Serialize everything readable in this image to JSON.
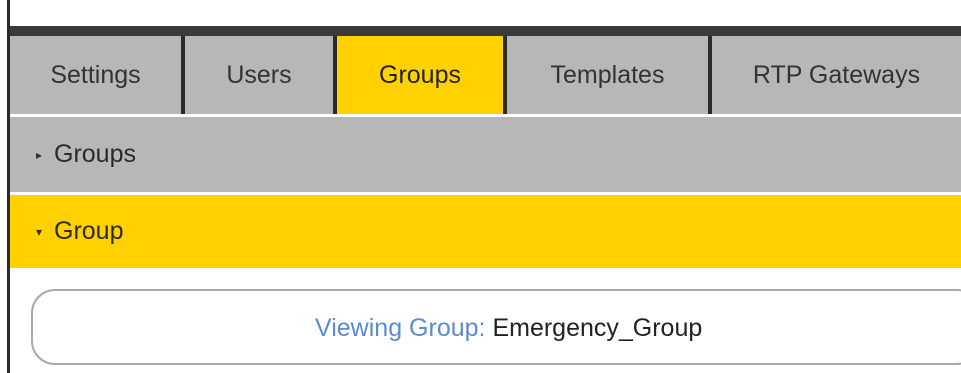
{
  "tabs": [
    {
      "label": "Settings",
      "active": false
    },
    {
      "label": "Users",
      "active": false
    },
    {
      "label": "Groups",
      "active": true
    },
    {
      "label": "Templates",
      "active": false
    },
    {
      "label": "RTP Gateways",
      "active": false
    }
  ],
  "sections": {
    "groups": {
      "label": "Groups",
      "expanded": false,
      "caret_icon": "caret-right-icon"
    },
    "group": {
      "label": "Group",
      "expanded": true,
      "caret_icon": "caret-down-icon"
    }
  },
  "viewing": {
    "label": "Viewing Group:",
    "value": "Emergency_Group"
  },
  "colors": {
    "active_tab": "#ffd100",
    "tab_bar": "#b7b7b7",
    "link_blue": "#5b8bd0"
  }
}
